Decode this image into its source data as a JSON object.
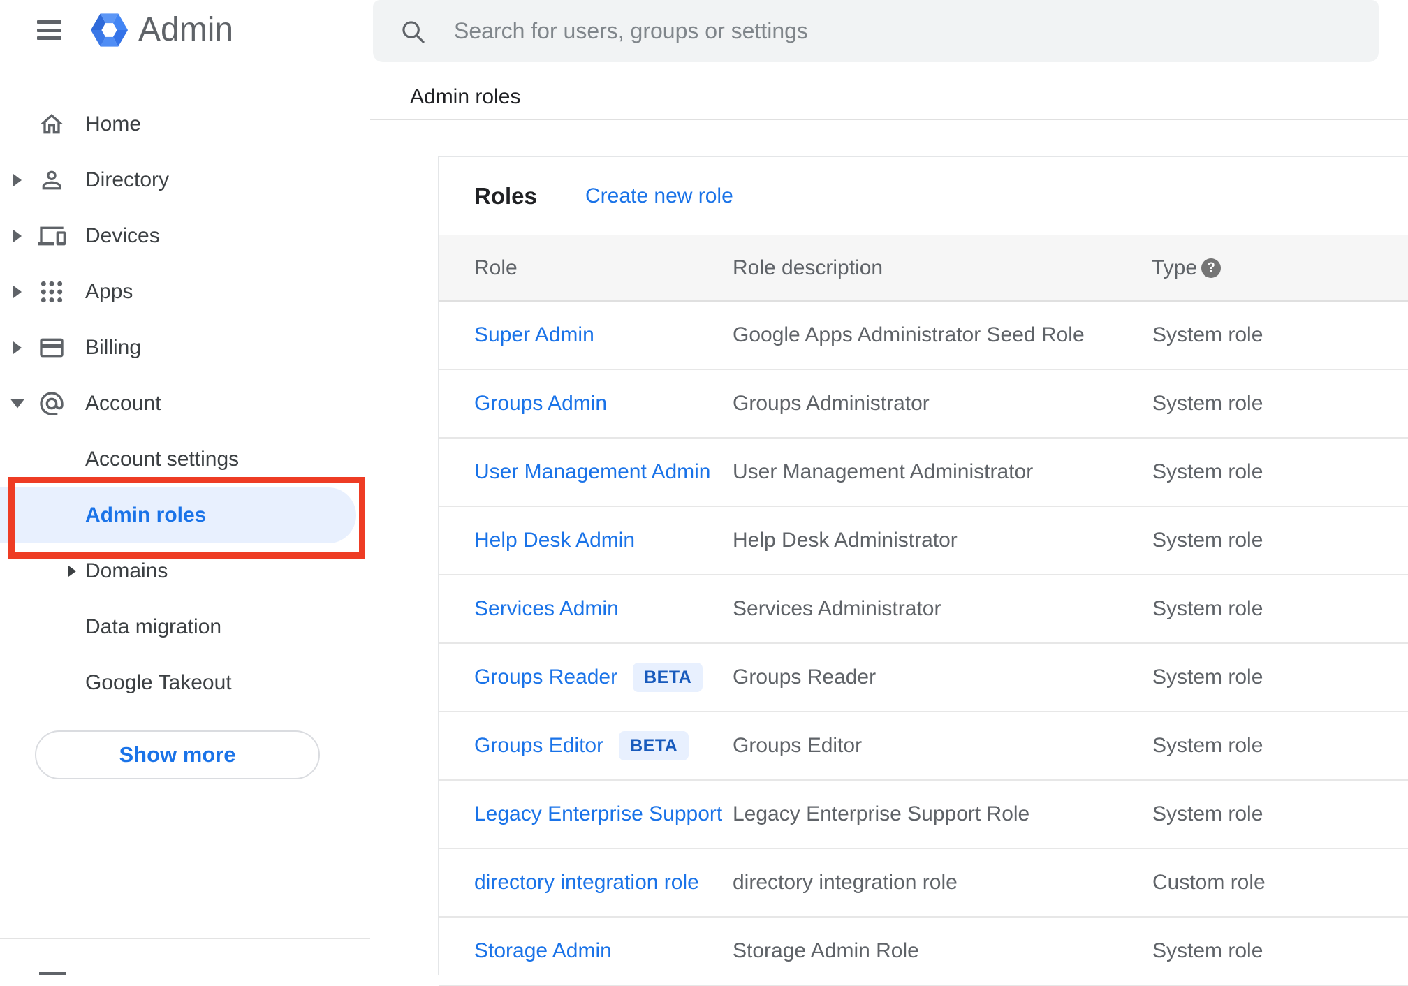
{
  "app": {
    "product_name": "Admin"
  },
  "search": {
    "placeholder": "Search for users, groups or settings"
  },
  "breadcrumb": {
    "label": "Admin roles"
  },
  "sidebar": {
    "items": [
      {
        "label": "Home"
      },
      {
        "label": "Directory"
      },
      {
        "label": "Devices"
      },
      {
        "label": "Apps"
      },
      {
        "label": "Billing"
      },
      {
        "label": "Account"
      }
    ],
    "account_children": [
      {
        "label": "Account settings"
      },
      {
        "label": "Admin roles",
        "active": true
      },
      {
        "label": "Domains"
      },
      {
        "label": "Data migration"
      },
      {
        "label": "Google Takeout"
      }
    ],
    "show_more_label": "Show more"
  },
  "main": {
    "card_title": "Roles",
    "create_new_role_label": "Create new role",
    "table": {
      "columns": {
        "role": "Role",
        "description": "Role description",
        "type": "Type"
      },
      "rows": [
        {
          "role": "Super Admin",
          "description": "Google Apps Administrator Seed Role",
          "type": "System role"
        },
        {
          "role": "Groups Admin",
          "description": "Groups Administrator",
          "type": "System role"
        },
        {
          "role": "User Management Admin",
          "description": "User Management Administrator",
          "type": "System role"
        },
        {
          "role": "Help Desk Admin",
          "description": "Help Desk Administrator",
          "type": "System role"
        },
        {
          "role": "Services Admin",
          "description": "Services Administrator",
          "type": "System role"
        },
        {
          "role": "Groups Reader",
          "badge": "BETA",
          "description": "Groups Reader",
          "type": "System role"
        },
        {
          "role": "Groups Editor",
          "badge": "BETA",
          "description": "Groups Editor",
          "type": "System role"
        },
        {
          "role": "Legacy Enterprise Support",
          "description": "Legacy Enterprise Support Role",
          "type": "System role"
        },
        {
          "role": "directory integration role",
          "description": "directory integration role",
          "type": "Custom role"
        },
        {
          "role": "Storage Admin",
          "description": "Storage Admin Role",
          "type": "System role"
        }
      ]
    }
  },
  "icons": {
    "help_glyph": "?"
  },
  "colors": {
    "link_blue": "#1a73e8",
    "active_item_bg": "#e8f0fe",
    "beta_badge_bg": "#e8f0fe",
    "beta_badge_text": "#185abc",
    "annotation_red": "#ee3c24",
    "search_bg": "#f1f3f4",
    "table_header_bg": "#f6f6f6",
    "logo_blue": "#4285f4",
    "icon_gray": "#5f6368"
  }
}
